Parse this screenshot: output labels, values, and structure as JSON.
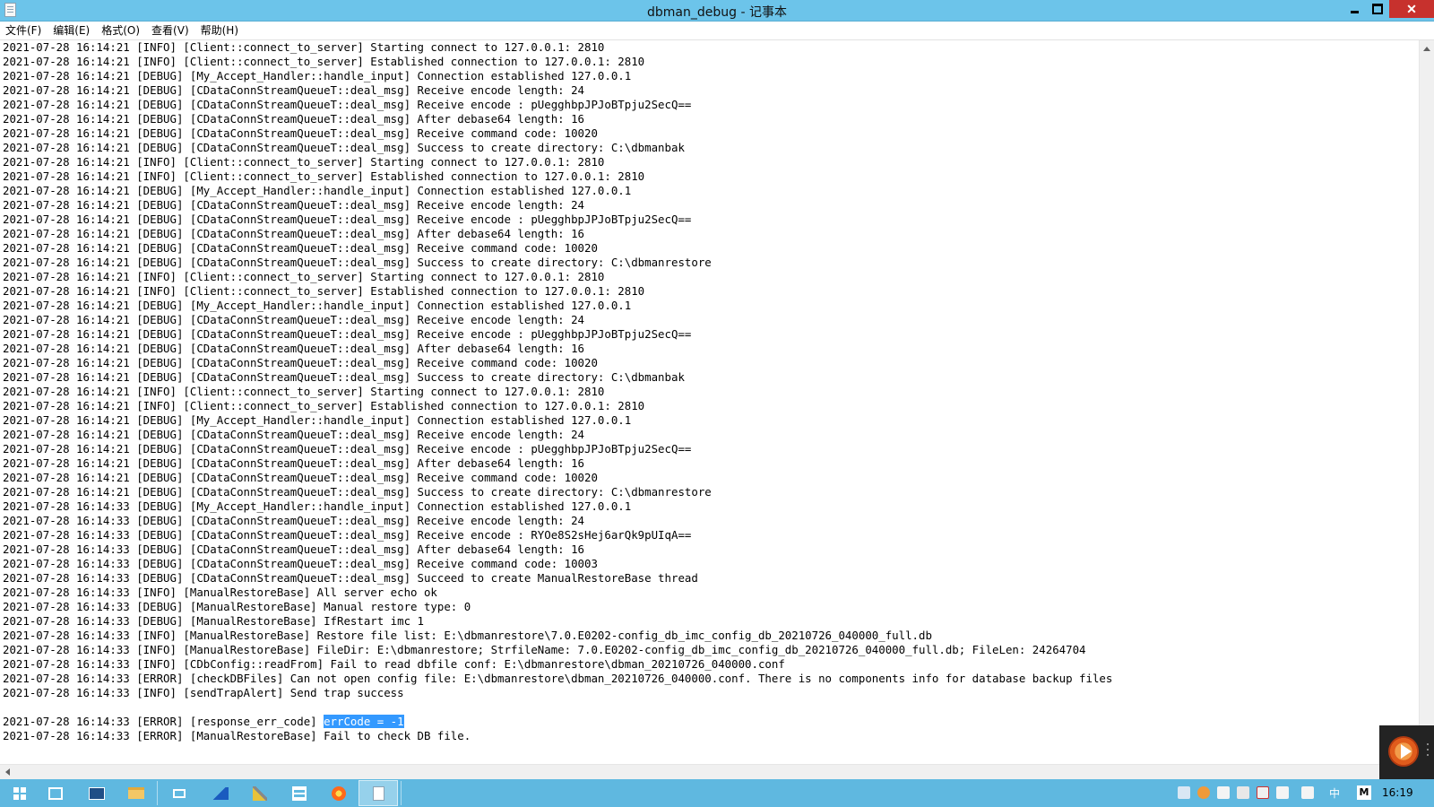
{
  "window": {
    "title": "dbman_debug - 记事本",
    "close_glyph": "✕"
  },
  "menu": {
    "items": [
      "文件(F)",
      "编辑(E)",
      "格式(O)",
      "查看(V)",
      "帮助(H)"
    ]
  },
  "log": {
    "lines": [
      "2021-07-28 16:14:21 [INFO] [Client::connect_to_server] Starting connect to 127.0.0.1: 2810",
      "2021-07-28 16:14:21 [INFO] [Client::connect_to_server] Established connection to 127.0.0.1: 2810",
      "2021-07-28 16:14:21 [DEBUG] [My_Accept_Handler::handle_input] Connection established 127.0.0.1",
      "2021-07-28 16:14:21 [DEBUG] [CDataConnStreamQueueT::deal_msg] Receive encode length: 24",
      "2021-07-28 16:14:21 [DEBUG] [CDataConnStreamQueueT::deal_msg] Receive encode : pUegghbpJPJoBTpju2SecQ==",
      "2021-07-28 16:14:21 [DEBUG] [CDataConnStreamQueueT::deal_msg] After debase64 length: 16",
      "2021-07-28 16:14:21 [DEBUG] [CDataConnStreamQueueT::deal_msg] Receive command code: 10020",
      "2021-07-28 16:14:21 [DEBUG] [CDataConnStreamQueueT::deal_msg] Success to create directory: C:\\dbmanbak",
      "2021-07-28 16:14:21 [INFO] [Client::connect_to_server] Starting connect to 127.0.0.1: 2810",
      "2021-07-28 16:14:21 [INFO] [Client::connect_to_server] Established connection to 127.0.0.1: 2810",
      "2021-07-28 16:14:21 [DEBUG] [My_Accept_Handler::handle_input] Connection established 127.0.0.1",
      "2021-07-28 16:14:21 [DEBUG] [CDataConnStreamQueueT::deal_msg] Receive encode length: 24",
      "2021-07-28 16:14:21 [DEBUG] [CDataConnStreamQueueT::deal_msg] Receive encode : pUegghbpJPJoBTpju2SecQ==",
      "2021-07-28 16:14:21 [DEBUG] [CDataConnStreamQueueT::deal_msg] After debase64 length: 16",
      "2021-07-28 16:14:21 [DEBUG] [CDataConnStreamQueueT::deal_msg] Receive command code: 10020",
      "2021-07-28 16:14:21 [DEBUG] [CDataConnStreamQueueT::deal_msg] Success to create directory: C:\\dbmanrestore",
      "2021-07-28 16:14:21 [INFO] [Client::connect_to_server] Starting connect to 127.0.0.1: 2810",
      "2021-07-28 16:14:21 [INFO] [Client::connect_to_server] Established connection to 127.0.0.1: 2810",
      "2021-07-28 16:14:21 [DEBUG] [My_Accept_Handler::handle_input] Connection established 127.0.0.1",
      "2021-07-28 16:14:21 [DEBUG] [CDataConnStreamQueueT::deal_msg] Receive encode length: 24",
      "2021-07-28 16:14:21 [DEBUG] [CDataConnStreamQueueT::deal_msg] Receive encode : pUegghbpJPJoBTpju2SecQ==",
      "2021-07-28 16:14:21 [DEBUG] [CDataConnStreamQueueT::deal_msg] After debase64 length: 16",
      "2021-07-28 16:14:21 [DEBUG] [CDataConnStreamQueueT::deal_msg] Receive command code: 10020",
      "2021-07-28 16:14:21 [DEBUG] [CDataConnStreamQueueT::deal_msg] Success to create directory: C:\\dbmanbak",
      "2021-07-28 16:14:21 [INFO] [Client::connect_to_server] Starting connect to 127.0.0.1: 2810",
      "2021-07-28 16:14:21 [INFO] [Client::connect_to_server] Established connection to 127.0.0.1: 2810",
      "2021-07-28 16:14:21 [DEBUG] [My_Accept_Handler::handle_input] Connection established 127.0.0.1",
      "2021-07-28 16:14:21 [DEBUG] [CDataConnStreamQueueT::deal_msg] Receive encode length: 24",
      "2021-07-28 16:14:21 [DEBUG] [CDataConnStreamQueueT::deal_msg] Receive encode : pUegghbpJPJoBTpju2SecQ==",
      "2021-07-28 16:14:21 [DEBUG] [CDataConnStreamQueueT::deal_msg] After debase64 length: 16",
      "2021-07-28 16:14:21 [DEBUG] [CDataConnStreamQueueT::deal_msg] Receive command code: 10020",
      "2021-07-28 16:14:21 [DEBUG] [CDataConnStreamQueueT::deal_msg] Success to create directory: C:\\dbmanrestore",
      "2021-07-28 16:14:33 [DEBUG] [My_Accept_Handler::handle_input] Connection established 127.0.0.1",
      "2021-07-28 16:14:33 [DEBUG] [CDataConnStreamQueueT::deal_msg] Receive encode length: 24",
      "2021-07-28 16:14:33 [DEBUG] [CDataConnStreamQueueT::deal_msg] Receive encode : RYOe8S2sHej6arQk9pUIqA==",
      "2021-07-28 16:14:33 [DEBUG] [CDataConnStreamQueueT::deal_msg] After debase64 length: 16",
      "2021-07-28 16:14:33 [DEBUG] [CDataConnStreamQueueT::deal_msg] Receive command code: 10003",
      "2021-07-28 16:14:33 [DEBUG] [CDataConnStreamQueueT::deal_msg] Succeed to create ManualRestoreBase thread",
      "2021-07-28 16:14:33 [INFO] [ManualRestoreBase] All server echo ok",
      "2021-07-28 16:14:33 [DEBUG] [ManualRestoreBase] Manual restore type: 0",
      "2021-07-28 16:14:33 [DEBUG] [ManualRestoreBase] IfRestart imc 1",
      "2021-07-28 16:14:33 [INFO] [ManualRestoreBase] Restore file list: E:\\dbmanrestore\\7.0.E0202-config_db_imc_config_db_20210726_040000_full.db",
      "2021-07-28 16:14:33 [INFO] [ManualRestoreBase] FileDir: E:\\dbmanrestore; StrfileName: 7.0.E0202-config_db_imc_config_db_20210726_040000_full.db; FileLen: 24264704",
      "2021-07-28 16:14:33 [INFO] [CDbConfig::readFrom] Fail to read dbfile conf: E:\\dbmanrestore\\dbman_20210726_040000.conf",
      "2021-07-28 16:14:33 [ERROR] [checkDBFiles] Can not open config file: E:\\dbmanrestore\\dbman_20210726_040000.conf. There is no components info for database backup files",
      "2021-07-28 16:14:33 [INFO] [sendTrapAlert] Send trap success",
      ""
    ],
    "selected_line": {
      "prefix": "2021-07-28 16:14:33 [ERROR] [response_err_code] ",
      "selection": "errCode = -1"
    },
    "last_line": "2021-07-28 16:14:33 [ERROR] [ManualRestoreBase] Fail to check DB file."
  },
  "taskbar": {
    "buttons": [
      "start-icon",
      "server-manager-icon",
      "powershell-icon",
      "file-explorer-icon",
      "task-view-icon",
      "wireshark-icon",
      "tools-icon",
      "registry-icon",
      "firefox-icon",
      "notepad-icon"
    ],
    "tray": {
      "ime_label": "中",
      "m_label": "M",
      "time": "16:19"
    }
  }
}
